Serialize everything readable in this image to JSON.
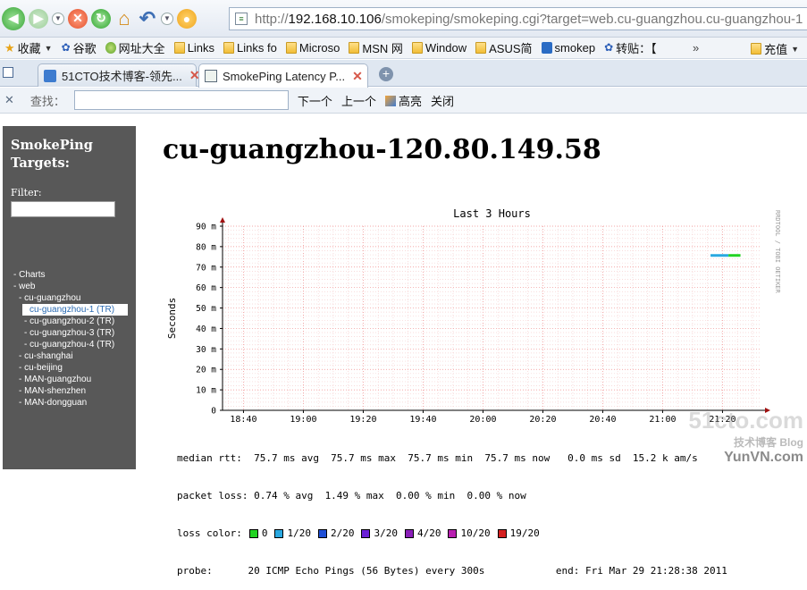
{
  "browser": {
    "url": {
      "scheme": "http://",
      "host": "192.168.10.106",
      "path": "/smokeping/smokeping.cgi?target=web.cu-guangzhou.cu-guangzhou-1"
    },
    "bookmarks": [
      {
        "label": "收藏",
        "icon": "star-icon",
        "dropdown": true
      },
      {
        "label": "谷歌",
        "icon": "paw-icon"
      },
      {
        "label": "网址大全",
        "icon": "globe-icon"
      },
      {
        "label": "Links",
        "icon": "folder-icon"
      },
      {
        "label": "Links fo",
        "icon": "folder-icon"
      },
      {
        "label": "Microso",
        "icon": "folder-icon"
      },
      {
        "label": "MSN 网",
        "icon": "folder-icon"
      },
      {
        "label": "Window",
        "icon": "folder-icon"
      },
      {
        "label": "ASUS简",
        "icon": "folder-icon"
      },
      {
        "label": "smokep",
        "icon": "blue-page-icon"
      },
      {
        "label": "转贴：【",
        "icon": "paw-icon"
      }
    ],
    "bookmarks_more": "»",
    "recharge_label": "充值",
    "tabs": [
      {
        "label": "51CTO技术博客-领先...",
        "active": false
      },
      {
        "label": "SmokePing Latency P...",
        "active": true
      }
    ],
    "find": {
      "label": "查找：",
      "next": "下一个",
      "prev": "上一个",
      "highlight": "高亮",
      "close": "关闭"
    }
  },
  "sidebar": {
    "title": "SmokePing Targets:",
    "filter_label": "Filter:",
    "tree": [
      {
        "label": "- Charts",
        "level": 1
      },
      {
        "label": "- web",
        "level": 1
      },
      {
        "label": "- cu-guangzhou",
        "level": 2
      },
      {
        "label": "cu-guangzhou-1 (TR)",
        "level": 3,
        "selected": true
      },
      {
        "label": "- cu-guangzhou-2 (TR)",
        "level": 3
      },
      {
        "label": "- cu-guangzhou-3 (TR)",
        "level": 3
      },
      {
        "label": "- cu-guangzhou-4 (TR)",
        "level": 3
      },
      {
        "label": "- cu-shanghai",
        "level": 2
      },
      {
        "label": "- cu-beijing",
        "level": 2
      },
      {
        "label": "- MAN-guangzhou",
        "level": 2
      },
      {
        "label": "- MAN-shenzhen",
        "level": 2
      },
      {
        "label": "- MAN-dongguan",
        "level": 2
      }
    ]
  },
  "main": {
    "title": "cu-guangzhou-120.80.149.58"
  },
  "chart_data": {
    "type": "line",
    "title": "Last 3 Hours",
    "ylabel": "Seconds",
    "side_label": "RRDTOOL / TOBI OETIKER",
    "x_ticks": [
      "18:40",
      "19:00",
      "19:20",
      "19:40",
      "20:00",
      "20:20",
      "20:40",
      "21:00",
      "21:20"
    ],
    "y_ticks": [
      "0",
      "10 m",
      "20 m",
      "30 m",
      "40 m",
      "50 m",
      "60 m",
      "70 m",
      "80 m",
      "90 m"
    ],
    "ylim_ms": [
      0,
      90
    ],
    "series": [
      {
        "x_start": "21:16",
        "x_end": "21:26",
        "y_ms": 75.7,
        "color": "#2aa8e0",
        "end_color": "#22d322"
      }
    ]
  },
  "stats": {
    "median": "median rtt:  75.7 ms avg  75.7 ms max  75.7 ms min  75.7 ms now   0.0 ms sd  15.2 k am/s",
    "loss": "packet loss: 0.74 % avg  1.49 % max  0.00 % min  0.00 % now",
    "loss_color_label": "loss color:",
    "loss_colors": [
      {
        "label": "0",
        "color": "#22d322"
      },
      {
        "label": "1/20",
        "color": "#2aa8e0"
      },
      {
        "label": "2/20",
        "color": "#1f4fd6"
      },
      {
        "label": "3/20",
        "color": "#6a1fd6"
      },
      {
        "label": "4/20",
        "color": "#8a1fb8"
      },
      {
        "label": "10/20",
        "color": "#b81fb0"
      },
      {
        "label": "19/20",
        "color": "#d41f1f"
      }
    ],
    "probe": "probe:      20 ICMP Echo Pings (56 Bytes) every 300s            end: Fri Mar 29 21:28:38 2011"
  },
  "watermark": {
    "line1": "51cto.com",
    "line2": "技术博客  Blog",
    "line3": "YunVN.com"
  }
}
